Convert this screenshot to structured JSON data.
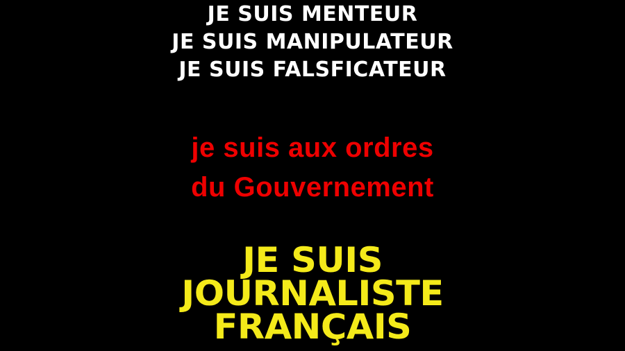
{
  "white_lines": [
    "JE SUIS MENTEUR",
    "JE SUIS MANIPULATEUR",
    "JE SUIS FALSFICATEUR"
  ],
  "red_lines": [
    "je suis aux ordres",
    "du Gouvernement"
  ],
  "yellow_lines": [
    "JE SUIS",
    "JOURNALISTE",
    "FRANÇAIS"
  ],
  "colors": {
    "background": "#000000",
    "white_text": "#ffffff",
    "red_text": "#ee0000",
    "yellow_text": "#f4ea1a"
  }
}
